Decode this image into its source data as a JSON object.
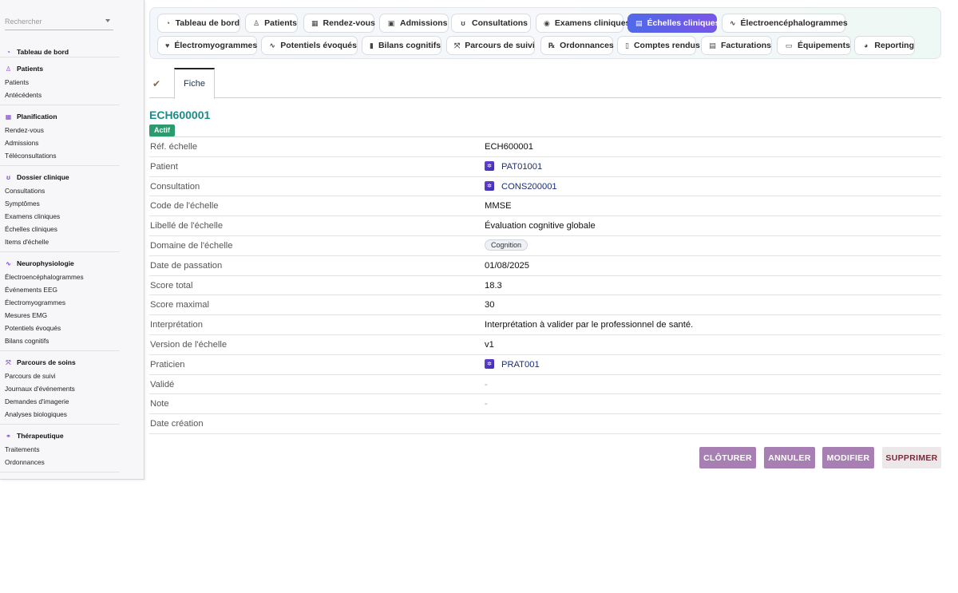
{
  "sidebar": {
    "search_placeholder": "Rechercher",
    "dashboard": "Tableau de bord",
    "sections": [
      {
        "title": "Patients",
        "icon": "user-icon",
        "items": [
          "Patients",
          "Antécédents"
        ]
      },
      {
        "title": "Planification",
        "icon": "calendar-icon",
        "items": [
          "Rendez-vous",
          "Admissions",
          "Téléconsultations"
        ]
      },
      {
        "title": "Dossier clinique",
        "icon": "stethoscope-icon",
        "items": [
          "Consultations",
          "Symptômes",
          "Examens cliniques",
          "Échelles cliniques",
          "Items d'échelle"
        ]
      },
      {
        "title": "Neurophysiologie",
        "icon": "pulse-icon",
        "items": [
          "Électroencéphalogrammes",
          "Événements EEG",
          "Électromyogrammes",
          "Mesures EMG",
          "Potentiels évoqués",
          "Bilans cognitifs"
        ]
      },
      {
        "title": "Parcours de soins",
        "icon": "route-icon",
        "items": [
          "Parcours de suivi",
          "Journaux d'événements",
          "Demandes d'imagerie",
          "Analyses biologiques"
        ]
      },
      {
        "title": "Thérapeutique",
        "icon": "pills-icon",
        "items": [
          "Traitements",
          "Ordonnances"
        ]
      }
    ]
  },
  "tabs": [
    {
      "label": "Tableau de bord",
      "icon": "gauge-icon",
      "glyph": "◔"
    },
    {
      "label": "Patients",
      "icon": "user-icon",
      "glyph": "♙"
    },
    {
      "label": "Rendez-vous",
      "icon": "calendar-icon",
      "glyph": "▦"
    },
    {
      "label": "Admissions",
      "icon": "clipboard-icon",
      "glyph": "▣"
    },
    {
      "label": "Consultations",
      "icon": "stethoscope-icon",
      "glyph": "ʊ"
    },
    {
      "label": "Examens cliniques",
      "icon": "brain-icon",
      "glyph": "◉"
    },
    {
      "label": "Échelles cliniques",
      "icon": "scale-icon",
      "glyph": "▤"
    },
    {
      "label": "Électroencéphalogrammes",
      "icon": "pulse-icon",
      "glyph": "∿"
    },
    {
      "label": "Électromyogrammes",
      "icon": "heart-pulse-icon",
      "glyph": "♥"
    },
    {
      "label": "Potentiels évoqués",
      "icon": "pulse-icon",
      "glyph": "∿"
    },
    {
      "label": "Bilans cognitifs",
      "icon": "book-icon",
      "glyph": "▮"
    },
    {
      "label": "Parcours de suivi",
      "icon": "route-icon",
      "glyph": "⤧"
    },
    {
      "label": "Ordonnances",
      "icon": "prescription-icon",
      "glyph": "℞"
    },
    {
      "label": "Comptes rendus",
      "icon": "file-icon",
      "glyph": "▯"
    },
    {
      "label": "Facturations",
      "icon": "invoice-icon",
      "glyph": "▤"
    },
    {
      "label": "Équipements",
      "icon": "monitor-icon",
      "glyph": "▭"
    },
    {
      "label": "Reporting",
      "icon": "pie-chart-icon",
      "glyph": "◕"
    }
  ],
  "active_tab": "Échelles cliniques",
  "subtabs": {
    "fiche": "Fiche"
  },
  "record": {
    "title": "ECH600001",
    "status": "Actif",
    "fields": [
      {
        "label": "Réf. échelle",
        "value": "ECH600001"
      },
      {
        "label": "Patient",
        "value": "PAT01001",
        "link": true
      },
      {
        "label": "Consultation",
        "value": "CONS200001",
        "link": true
      },
      {
        "label": "Code de l'échelle",
        "value": "MMSE"
      },
      {
        "label": "Libellé de l'échelle",
        "value": "Évaluation cognitive globale"
      },
      {
        "label": "Domaine de l'échelle",
        "value": "Cognition",
        "chip": true
      },
      {
        "label": "Date de passation",
        "value": "01/08/2025"
      },
      {
        "label": "Score total",
        "value": "18.3"
      },
      {
        "label": "Score maximal",
        "value": "30"
      },
      {
        "label": "Interprétation",
        "value": "Interprétation à valider par le professionnel de santé."
      },
      {
        "label": "Version de l'échelle",
        "value": "v1"
      },
      {
        "label": "Praticien",
        "value": "PRAT001",
        "link": true
      },
      {
        "label": "Validé",
        "value": "-",
        "dash": true
      },
      {
        "label": "Note",
        "value": "-",
        "dash": true
      },
      {
        "label": "Date création",
        "value": ""
      }
    ]
  },
  "actions": {
    "close": "CLÔTURER",
    "cancel": "ANNULER",
    "edit": "MODIFIER",
    "delete": "SUPPRIMER"
  },
  "colors": {
    "accent": "#7b55e8",
    "title": "#1f8a8a",
    "status": "#2b9a6e",
    "action": "#a87fb3"
  }
}
